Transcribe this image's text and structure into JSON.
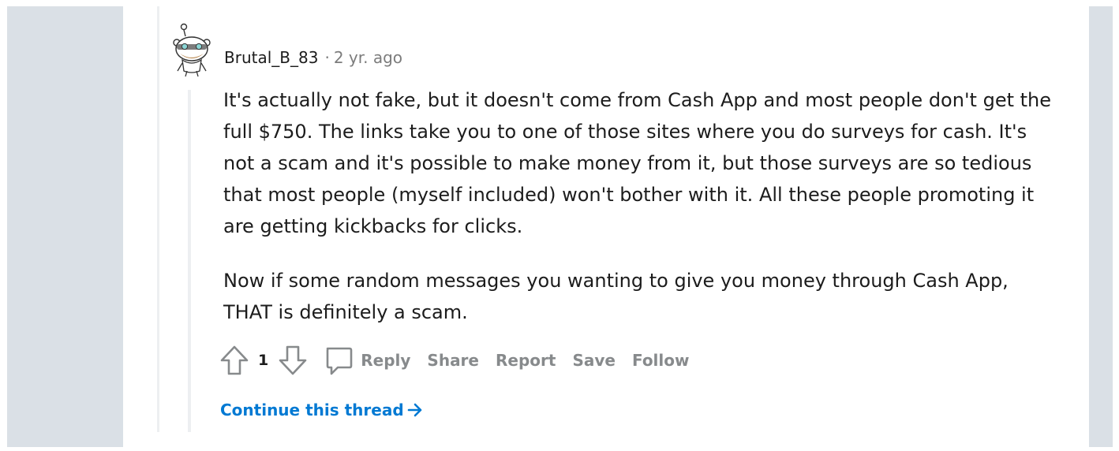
{
  "comment": {
    "author": "Brutal_B_83",
    "separator": "·",
    "timestamp": "2 yr. ago",
    "paragraphs": [
      "It's actually not fake, but it doesn't come from Cash App and most people don't get the full $750. The links take you to one of those sites where you do surveys for cash. It's not a scam and it's possible to make money from it, but those surveys are so tedious that most people (myself included) won't bother with it. All these people promoting it are getting kickbacks for clicks.",
      "Now if some random messages you wanting to give you money through Cash App, THAT is definitely a scam."
    ],
    "score": "1"
  },
  "actions": {
    "reply": "Reply",
    "share": "Share",
    "report": "Report",
    "save": "Save",
    "follow": "Follow"
  },
  "continue_thread": "Continue this thread",
  "icons": {
    "avatar": "snoo-avatar-icon",
    "upvote": "upvote-arrow-icon",
    "downvote": "downvote-arrow-icon",
    "reply": "speech-bubble-icon",
    "continue": "arrow-right-icon"
  },
  "colors": {
    "page_background": "#dae0e6",
    "card_background": "#ffffff",
    "text": "#1c1c1c",
    "meta_text": "#7c7c7c",
    "action_text": "#878a8c",
    "link": "#0079d3",
    "thread_line": "#edeff1"
  }
}
